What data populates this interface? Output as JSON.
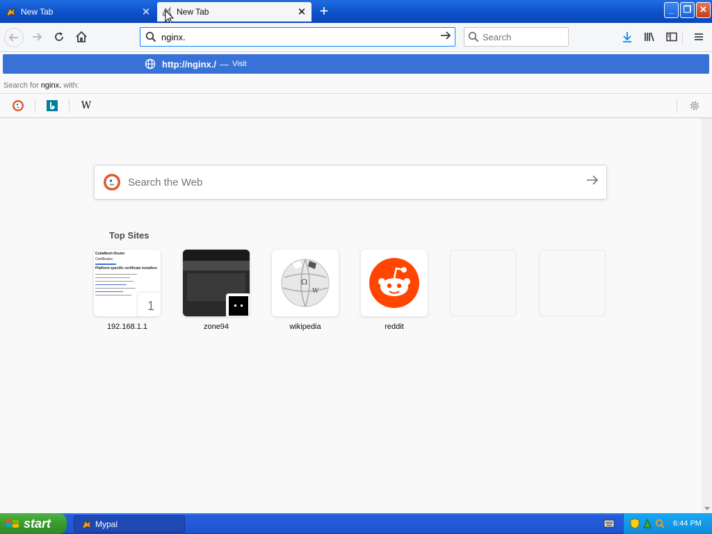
{
  "tabs": [
    {
      "title": "New Tab",
      "close": "✕"
    },
    {
      "title": "New Tab",
      "close": "✕"
    }
  ],
  "new_tab_symbol": "+",
  "window_controls": {
    "minimize": "_",
    "maximize": "❐",
    "close": "✕"
  },
  "urlbar": {
    "value": "nginx."
  },
  "searchbar": {
    "placeholder": "Search"
  },
  "autocomplete": {
    "url": "http://nginx./",
    "dash": "—",
    "action": "Visit",
    "search_for_prefix": "Search for ",
    "search_for_term": "nginx.",
    "search_for_suffix": " with:",
    "engines": [
      "duckduckgo-icon",
      "bing-icon",
      "wikipedia-icon"
    ],
    "wikipedia_letter": "W"
  },
  "content": {
    "search_placeholder": "Search the Web",
    "top_sites_title": "Top Sites",
    "top_sites": [
      {
        "label": "192.168.1.1",
        "badge": "1"
      },
      {
        "label": "zone94"
      },
      {
        "label": "wikipedia"
      },
      {
        "label": "reddit"
      },
      {
        "label": ""
      },
      {
        "label": ""
      }
    ],
    "router_thumb": {
      "title": "CoilaMesh Router",
      "line1": "Certificates",
      "line2": "Platform-specific certificate installers"
    }
  },
  "taskbar": {
    "start_label": "start",
    "items": [
      {
        "label": "Mypal"
      }
    ],
    "clock": "6:44 PM"
  },
  "colors": {
    "accent": "#0a84ff",
    "suggest_highlight": "#3872d6",
    "titlebar": "#0c4fc7",
    "reddit": "#ff4500"
  }
}
